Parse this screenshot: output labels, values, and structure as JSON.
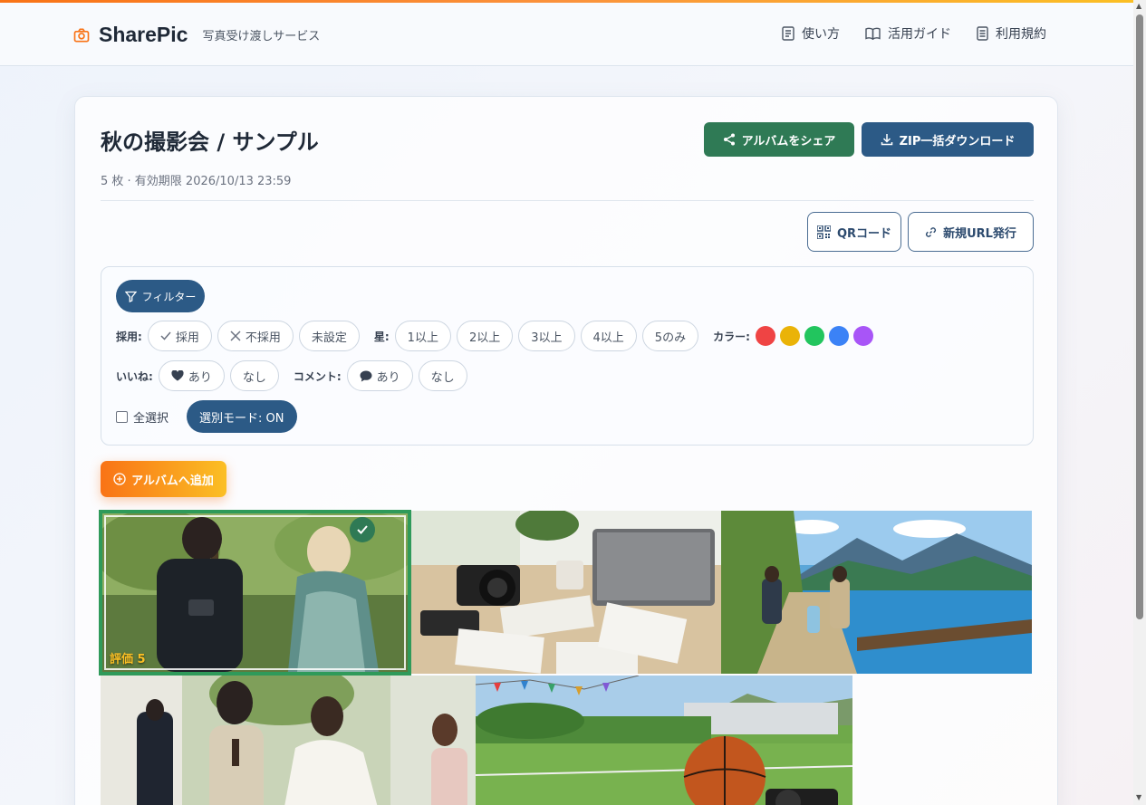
{
  "header": {
    "brand_name": "SharePic",
    "tagline": "写真受け渡しサービス",
    "nav": [
      {
        "label": "使い方",
        "icon": "document-icon"
      },
      {
        "label": "活用ガイド",
        "icon": "book-icon"
      },
      {
        "label": "利用規約",
        "icon": "file-icon"
      }
    ]
  },
  "album": {
    "title": "秋の撮影会 / サンプル",
    "meta": "5 枚 · 有効期限 2026/10/13 23:59",
    "share_label": "アルバムをシェア",
    "zip_label": "ZIP一括ダウンロード",
    "qr_label": "QRコード",
    "new_url_label": "新規URL発行"
  },
  "filters": {
    "toggle_label": "フィルター",
    "adoption_label": "採用:",
    "adoption_options": [
      "採用",
      "不採用",
      "未設定"
    ],
    "star_label": "星:",
    "star_options": [
      "1以上",
      "2以上",
      "3以上",
      "4以上",
      "5のみ"
    ],
    "color_label": "カラー:",
    "colors": [
      "#ef4444",
      "#eab308",
      "#22c55e",
      "#3b82f6",
      "#a855f7"
    ],
    "like_label": "いいね:",
    "like_options": [
      "あり",
      "なし"
    ],
    "comment_label": "コメント:",
    "comment_options": [
      "あり",
      "なし"
    ],
    "select_all_label": "全選択",
    "mode_label": "選別モード: ON"
  },
  "actions": {
    "add_to_album_label": "アルバムへ追加"
  },
  "photos": [
    {
      "selected": true,
      "rating_label": "評価 5"
    },
    {
      "selected": false
    },
    {
      "selected": false
    },
    {
      "selected": false
    },
    {
      "selected": false
    }
  ],
  "colors": {
    "accent_orange": "#f97316",
    "primary_blue": "#2c5a86",
    "share_green": "#2f7a55",
    "selected_border": "#2f9a5a"
  }
}
